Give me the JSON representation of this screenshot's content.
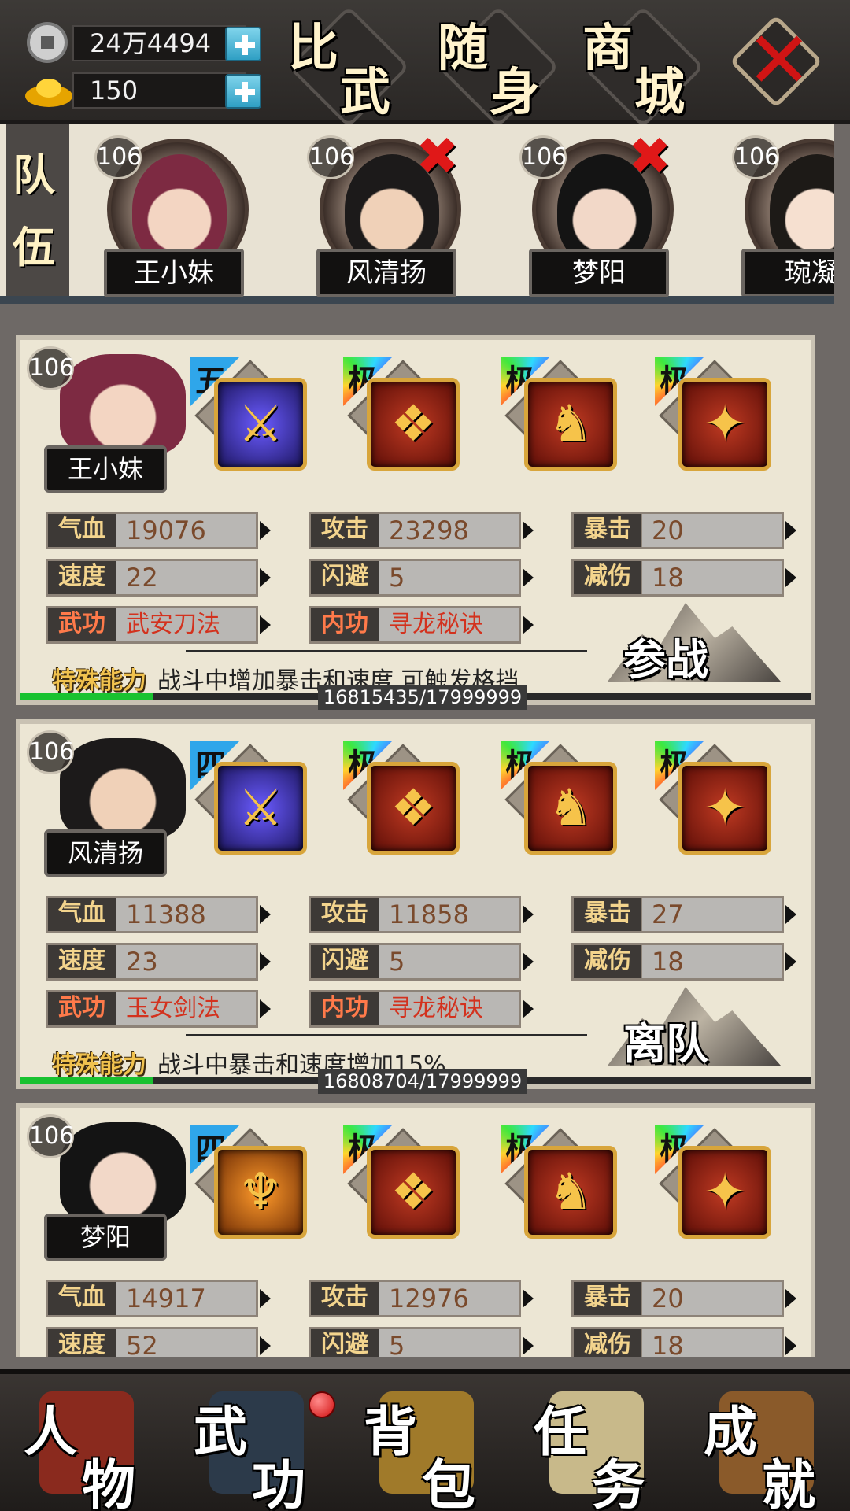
{
  "currency": {
    "silver": "24万4494",
    "gold": "150"
  },
  "top_buttons": [
    {
      "c1": "比",
      "c2": "武"
    },
    {
      "c1": "随",
      "c2": "身"
    },
    {
      "c1": "商",
      "c2": "城"
    }
  ],
  "close_label": "✕",
  "team": {
    "label_top": "队",
    "label_bottom": "伍",
    "members": [
      {
        "level": "106",
        "name": "王小妹",
        "removable": false
      },
      {
        "level": "106",
        "name": "风清扬",
        "removable": true
      },
      {
        "level": "106",
        "name": "梦阳",
        "removable": true
      },
      {
        "level": "106",
        "name": "琬凝",
        "removable": false
      }
    ]
  },
  "heroes": [
    {
      "level": "106",
      "name": "王小妹",
      "equip_tags": [
        "五",
        "极",
        "极",
        "极"
      ],
      "stats": {
        "hp_label": "气血",
        "hp": "19076",
        "atk_label": "攻击",
        "atk": "23298",
        "crit_label": "暴击",
        "crit": "20",
        "spd_label": "速度",
        "spd": "22",
        "dodge_label": "闪避",
        "dodge": "5",
        "dr_label": "减伤",
        "dr": "18",
        "skill_label": "武功",
        "skill": "武安刀法",
        "inner_label": "内功",
        "inner": "寻龙秘诀"
      },
      "special_label": "特殊能力",
      "special": "战斗中增加暴击和速度,可触发格挡",
      "exp": "16815435/17999999",
      "exp_ratio": 0.934,
      "action": "参战"
    },
    {
      "level": "106",
      "name": "风清扬",
      "equip_tags": [
        "四",
        "极",
        "极",
        "极"
      ],
      "stats": {
        "hp_label": "气血",
        "hp": "11388",
        "atk_label": "攻击",
        "atk": "11858",
        "crit_label": "暴击",
        "crit": "27",
        "spd_label": "速度",
        "spd": "23",
        "dodge_label": "闪避",
        "dodge": "5",
        "dr_label": "减伤",
        "dr": "18",
        "skill_label": "武功",
        "skill": "玉女剑法",
        "inner_label": "内功",
        "inner": "寻龙秘诀"
      },
      "special_label": "特殊能力",
      "special": "战斗中暴击和速度增加15%",
      "exp": "16808704/17999999",
      "exp_ratio": 0.934,
      "action": "离队"
    },
    {
      "level": "106",
      "name": "梦阳",
      "equip_tags": [
        "四",
        "极",
        "极",
        "极"
      ],
      "stats": {
        "hp_label": "气血",
        "hp": "14917",
        "atk_label": "攻击",
        "atk": "12976",
        "crit_label": "暴击",
        "crit": "20",
        "spd_label": "速度",
        "spd": "52",
        "dodge_label": "闪避",
        "dodge": "5",
        "dr_label": "减伤",
        "dr": "18"
      }
    }
  ],
  "nav": [
    {
      "c1": "人",
      "c2": "物"
    },
    {
      "c1": "武",
      "c2": "功"
    },
    {
      "c1": "背",
      "c2": "包"
    },
    {
      "c1": "任",
      "c2": "务"
    },
    {
      "c1": "成",
      "c2": "就"
    }
  ]
}
